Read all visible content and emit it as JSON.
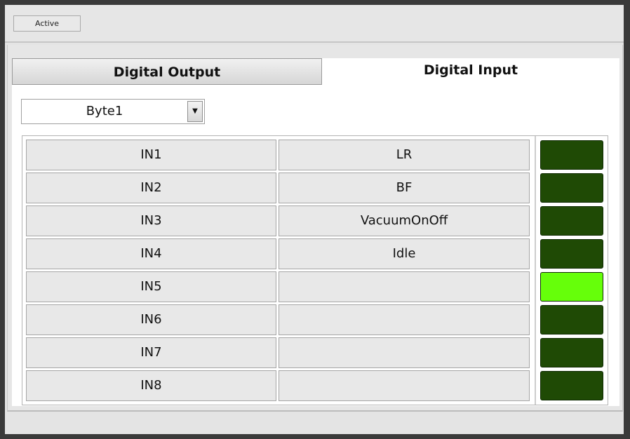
{
  "toolbar": {
    "active_label": "Active"
  },
  "tabs": [
    {
      "label": "Digital Output",
      "selected": false
    },
    {
      "label": "Digital Input",
      "selected": true
    }
  ],
  "byte_selector": {
    "value": "Byte1"
  },
  "colors": {
    "led_off": "#1f4a05",
    "led_on": "#66ff0a"
  },
  "inputs": [
    {
      "id": "IN1",
      "name": "LR",
      "state": "off"
    },
    {
      "id": "IN2",
      "name": "BF",
      "state": "off"
    },
    {
      "id": "IN3",
      "name": "VacuumOnOff",
      "state": "off"
    },
    {
      "id": "IN4",
      "name": "Idle",
      "state": "off"
    },
    {
      "id": "IN5",
      "name": "",
      "state": "on"
    },
    {
      "id": "IN6",
      "name": "",
      "state": "off"
    },
    {
      "id": "IN7",
      "name": "",
      "state": "off"
    },
    {
      "id": "IN8",
      "name": "",
      "state": "off"
    }
  ]
}
